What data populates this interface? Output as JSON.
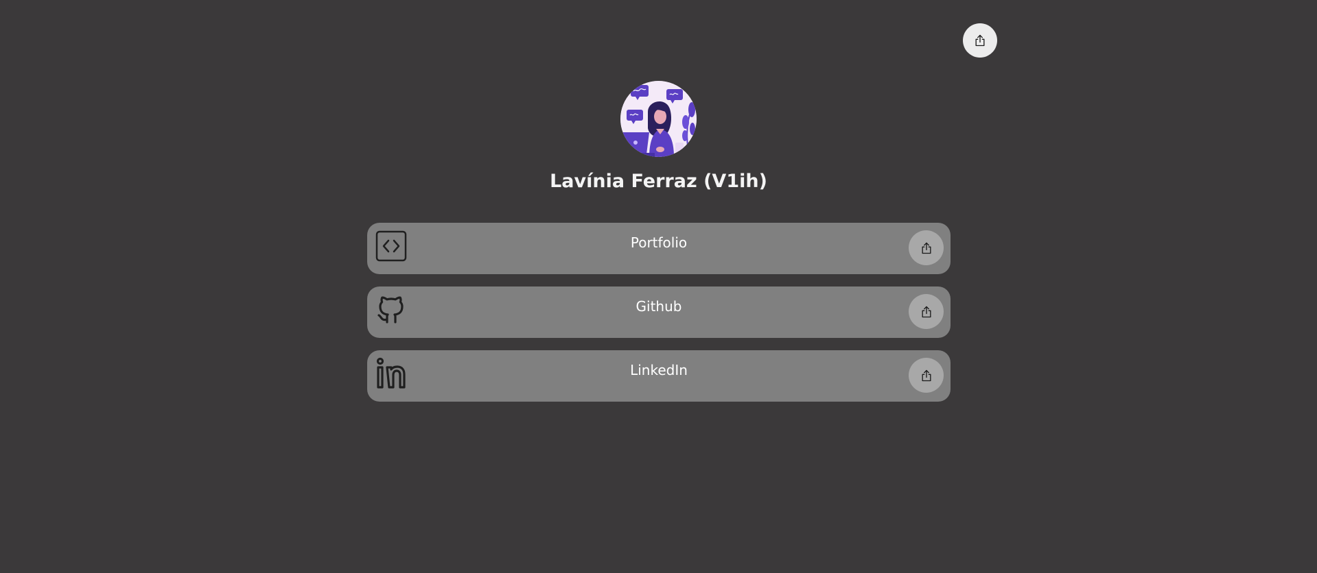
{
  "header": {
    "share_icon": "share-icon"
  },
  "profile": {
    "name": "Lavínia Ferraz (V1ih)",
    "avatar_icon": "developer-illustration"
  },
  "links": [
    {
      "label": "Portfolio",
      "icon": "code-brackets-icon"
    },
    {
      "label": "Github",
      "icon": "github-icon"
    },
    {
      "label": "LinkedIn",
      "icon": "linkedin-icon"
    }
  ],
  "colors": {
    "background": "#3b393a",
    "card": "#808080",
    "share_button": "#a8a8a8",
    "top_share_button": "#ececec",
    "avatar_accent": "#5b3fc4",
    "avatar_bg": "#f4eaf8"
  }
}
